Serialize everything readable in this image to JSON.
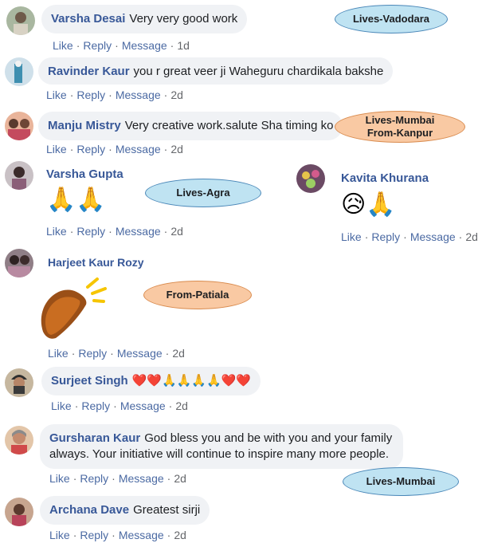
{
  "comments": [
    {
      "name": "Varsha Desai",
      "text": "Very very good work",
      "like": "Like",
      "reply": "Reply",
      "message": "Message",
      "time": "1d"
    },
    {
      "name": "Ravinder Kaur",
      "text": "you r great veer ji Waheguru chardikala bakshe",
      "like": "Like",
      "reply": "Reply",
      "message": "Message",
      "time": "2d"
    },
    {
      "name": "Manju Mistry",
      "text": "Very creative work.salute Sha timing ko",
      "like": "Like",
      "reply": "Reply",
      "message": "Message",
      "time": "2d"
    },
    {
      "name": "Varsha Gupta",
      "text": "🙏🙏",
      "like": "Like",
      "reply": "Reply",
      "message": "Message",
      "time": "2d"
    },
    {
      "name": "Kavita Khurana",
      "text": "😥🙏",
      "like": "Like",
      "reply": "Reply",
      "message": "Message",
      "time": "2d"
    },
    {
      "name": "Harjeet Kaur Rozy",
      "text": "👏",
      "like": "Like",
      "reply": "Reply",
      "message": "Message",
      "time": "2d"
    },
    {
      "name": "Surjeet Singh",
      "text": "❤️❤️🙏🙏🙏🙏❤️❤️",
      "like": "Like",
      "reply": "Reply",
      "message": "Message",
      "time": "2d"
    },
    {
      "name": "Gursharan Kaur",
      "text": "God bless you and be with you and your family always. Your initiative will continue to inspire many more people.",
      "like": "Like",
      "reply": "Reply",
      "message": "Message",
      "time": "2d"
    },
    {
      "name": "Archana Dave",
      "text": "Greatest sirji",
      "like": "Like",
      "reply": "Reply",
      "message": "Message",
      "time": "2d"
    }
  ],
  "callouts": {
    "vadodara": "Lives-Vadodara",
    "mumbai_kanpur_1": "Lives-Mumbai",
    "mumbai_kanpur_2": "From-Kanpur",
    "agra": "Lives-Agra",
    "patiala": "From-Patiala",
    "mumbai": "Lives-Mumbai"
  },
  "colors": {
    "name": "#385898",
    "bubble": "#f0f2f5",
    "meta": "#65676b",
    "callout_blue": "#bfe3f2",
    "callout_orange": "#f9c9a3"
  }
}
